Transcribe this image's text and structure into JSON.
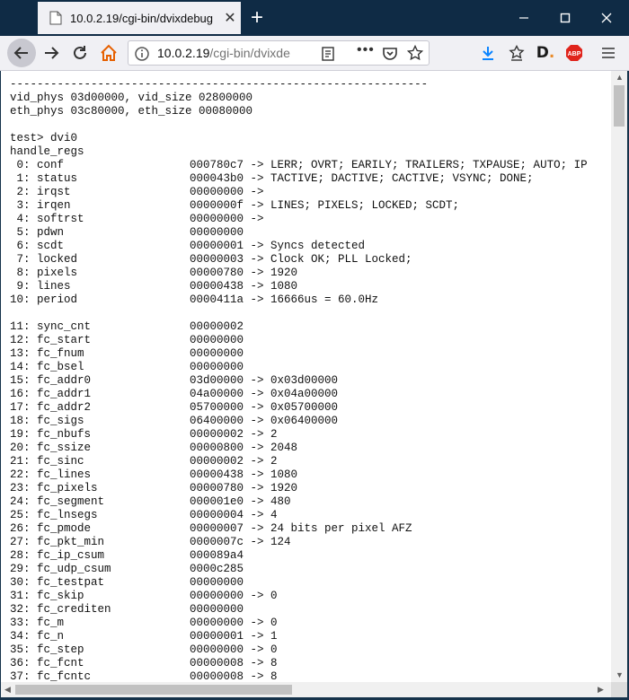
{
  "tab": {
    "title": "10.0.2.19/cgi-bin/dvixdebug",
    "favicon": "page-icon",
    "close": "✕"
  },
  "newtab": "+",
  "window_controls": {
    "minimize": "minimize-icon",
    "maximize": "maximize-icon",
    "close": "close-icon"
  },
  "url": {
    "host": "10.0.2.19",
    "path": "/cgi-bin/dvixde"
  },
  "toolbar_icons": [
    "back-icon",
    "forward-icon",
    "reload-icon",
    "home-icon",
    "download-icon",
    "bookmark-icon",
    "dashlane-icon",
    "adblock-icon",
    "menu-icon"
  ],
  "colors": {
    "tabbar": "#0f2b45",
    "toolbar": "#f0f0f4",
    "download": "#0a84ff",
    "abp": "#e0241c"
  },
  "console": {
    "separator": "--------------------------------------------------------------",
    "vid_line": "vid_phys 03d00000, vid_size 02800000",
    "eth_line": "eth_phys 03c80000, eth_size 00080000",
    "prompt": "test> dvi0",
    "header": "handle_regs",
    "group1": [
      {
        "label": " 0: conf",
        "value": "000780c7 -> LERR; OVRT; EARILY; TRAILERS; TXPAUSE; AUTO; IP"
      },
      {
        "label": " 1: status",
        "value": "000043b0 -> TACTIVE; DACTIVE; CACTIVE; VSYNC; DONE;"
      },
      {
        "label": " 2: irqst",
        "value": "00000000 ->"
      },
      {
        "label": " 3: irqen",
        "value": "0000000f -> LINES; PIXELS; LOCKED; SCDT;"
      },
      {
        "label": " 4: softrst",
        "value": "00000000 ->"
      },
      {
        "label": " 5: pdwn",
        "value": "00000000"
      },
      {
        "label": " 6: scdt",
        "value": "00000001 -> Syncs detected"
      },
      {
        "label": " 7: locked",
        "value": "00000003 -> Clock OK; PLL Locked;"
      },
      {
        "label": " 8: pixels",
        "value": "00000780 -> 1920"
      },
      {
        "label": " 9: lines",
        "value": "00000438 -> 1080"
      },
      {
        "label": "10: period",
        "value": "0000411a -> 16666us = 60.0Hz"
      }
    ],
    "group2": [
      {
        "label": "11: sync_cnt",
        "value": "00000002"
      },
      {
        "label": "12: fc_start",
        "value": "00000000"
      },
      {
        "label": "13: fc_fnum",
        "value": "00000000"
      },
      {
        "label": "14: fc_bsel",
        "value": "00000000"
      },
      {
        "label": "15: fc_addr0",
        "value": "03d00000 -> 0x03d00000"
      },
      {
        "label": "16: fc_addr1",
        "value": "04a00000 -> 0x04a00000"
      },
      {
        "label": "17: fc_addr2",
        "value": "05700000 -> 0x05700000"
      },
      {
        "label": "18: fc_sigs",
        "value": "06400000 -> 0x06400000"
      },
      {
        "label": "19: fc_nbufs",
        "value": "00000002 -> 2"
      },
      {
        "label": "20: fc_ssize",
        "value": "00000800 -> 2048"
      },
      {
        "label": "21: fc_sinc",
        "value": "00000002 -> 2"
      },
      {
        "label": "22: fc_lines",
        "value": "00000438 -> 1080"
      },
      {
        "label": "23: fc_pixels",
        "value": "00000780 -> 1920"
      },
      {
        "label": "24: fc_segment",
        "value": "000001e0 -> 480"
      },
      {
        "label": "25: fc_lnsegs",
        "value": "00000004 -> 4"
      },
      {
        "label": "26: fc_pmode",
        "value": "00000007 -> 24 bits per pixel AFZ"
      },
      {
        "label": "27: fc_pkt_min",
        "value": "0000007c -> 124"
      },
      {
        "label": "28: fc_ip_csum",
        "value": "000089a4"
      },
      {
        "label": "29: fc_udp_csum",
        "value": "0000c285"
      },
      {
        "label": "30: fc_testpat",
        "value": "00000000"
      },
      {
        "label": "31: fc_skip",
        "value": "00000000 -> 0"
      },
      {
        "label": "32: fc_crediten",
        "value": "00000000"
      },
      {
        "label": "33: fc_m",
        "value": "00000000 -> 0"
      },
      {
        "label": "34: fc_n",
        "value": "00000001 -> 1"
      },
      {
        "label": "35: fc_step",
        "value": "00000000 -> 0"
      },
      {
        "label": "36: fc_fcnt",
        "value": "00000008 -> 8"
      },
      {
        "label": "37: fc_fcntc",
        "value": "00000008 -> 8"
      }
    ]
  }
}
